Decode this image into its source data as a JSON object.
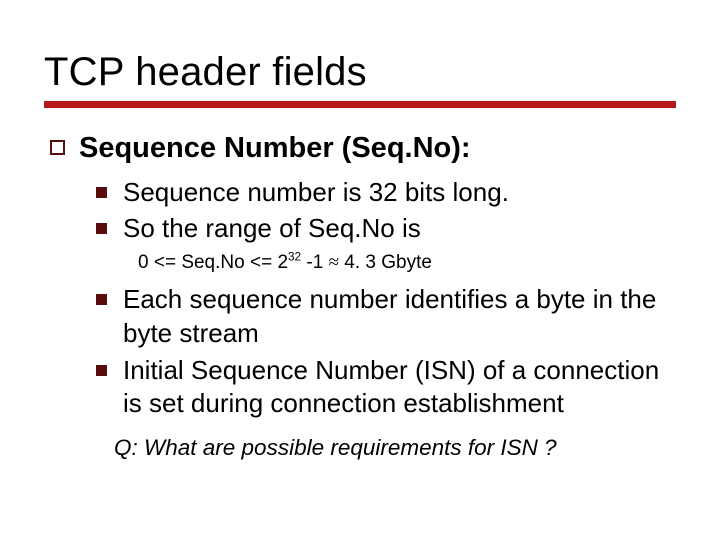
{
  "title": "TCP header fields",
  "main_bullet": "Sequence Number (Seq.No):",
  "sub_bullets_a": [
    "Sequence number is 32 bits long.",
    "So the range of Seq.No is"
  ],
  "formula": {
    "lhs": "0 <= Seq.No <= 2",
    "exp": "32",
    "mid": " -1  ",
    "approx_symbol": "≈",
    "rhs": " 4. 3 Gbyte"
  },
  "sub_bullets_b": [
    "Each  sequence number identifies a byte in the byte stream",
    "Initial Sequence Number (ISN) of a connection is set during connection establishment"
  ],
  "question": "Q: What are possible requirements for ISN ?"
}
